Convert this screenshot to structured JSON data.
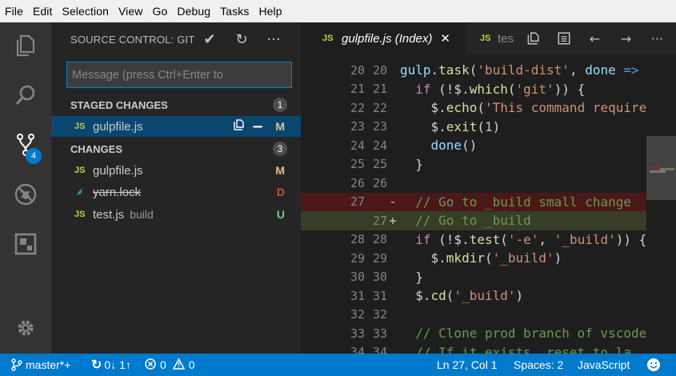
{
  "menu": [
    "File",
    "Edit",
    "Selection",
    "View",
    "Go",
    "Debug",
    "Tasks",
    "Help"
  ],
  "activity": {
    "scm_badge": "4"
  },
  "sidebar": {
    "title": "SOURCE CONTROL: GIT",
    "message_placeholder": "Message (press Ctrl+Enter to",
    "staged": {
      "label": "STAGED CHANGES",
      "count": "1",
      "files": [
        {
          "icon": "JS",
          "name": "gulpfile.js",
          "status": "M"
        }
      ]
    },
    "changes": {
      "label": "CHANGES",
      "count": "3",
      "files": [
        {
          "icon": "JS",
          "name": "gulpfile.js",
          "desc": "",
          "status": "M"
        },
        {
          "icon": "",
          "name": "yarn.lock",
          "desc": "",
          "status": "D"
        },
        {
          "icon": "JS",
          "name": "test.js",
          "desc": "build",
          "status": "U"
        }
      ]
    }
  },
  "editor": {
    "active_tab": {
      "icon": "JS",
      "label": "gulpfile.js (Index)"
    },
    "second_tab": {
      "icon": "JS",
      "label": "tes"
    },
    "lines": [
      {
        "a": "20",
        "b": "20",
        "m": "",
        "t": "",
        "code": "gulp.task('build-dist', done =>"
      },
      {
        "a": "21",
        "b": "21",
        "m": "",
        "t": "",
        "code": "  if (!$.which('git')) {"
      },
      {
        "a": "22",
        "b": "22",
        "m": "",
        "t": "",
        "code": "    $.echo('This command require"
      },
      {
        "a": "23",
        "b": "23",
        "m": "",
        "t": "",
        "code": "    $.exit(1)"
      },
      {
        "a": "24",
        "b": "24",
        "m": "",
        "t": "",
        "code": "    done()"
      },
      {
        "a": "25",
        "b": "25",
        "m": "",
        "t": "",
        "code": "  }"
      },
      {
        "a": "26",
        "b": "26",
        "m": "",
        "t": "",
        "code": ""
      },
      {
        "a": "27",
        "b": "",
        "m": "-",
        "t": "removed",
        "code": "  // Go to _build small change"
      },
      {
        "a": "",
        "b": "27",
        "m": "+",
        "t": "added",
        "code": "  // Go to _build"
      },
      {
        "a": "28",
        "b": "28",
        "m": "",
        "t": "",
        "code": "  if (!$.test('-e', '_build')) {"
      },
      {
        "a": "29",
        "b": "29",
        "m": "",
        "t": "",
        "code": "    $.mkdir('_build')"
      },
      {
        "a": "30",
        "b": "30",
        "m": "",
        "t": "",
        "code": "  }"
      },
      {
        "a": "31",
        "b": "31",
        "m": "",
        "t": "",
        "code": "  $.cd('_build')"
      },
      {
        "a": "32",
        "b": "32",
        "m": "",
        "t": "",
        "code": ""
      },
      {
        "a": "33",
        "b": "33",
        "m": "",
        "t": "",
        "code": "  // Clone prod branch of vscode"
      },
      {
        "a": "34",
        "b": "34",
        "m": "",
        "t": "",
        "code": "  // If it exists, reset to la"
      }
    ]
  },
  "status": {
    "branch": "master*+",
    "sync": "0↓ 1↑",
    "errors": "0",
    "warnings": "0",
    "position": "Ln 27, Col 1",
    "spaces": "Spaces: 2",
    "language": "JavaScript"
  },
  "colors": {
    "accent": "#007acc",
    "modified": "#e2c08d",
    "deleted": "#c74e39",
    "untracked": "#73c991"
  }
}
